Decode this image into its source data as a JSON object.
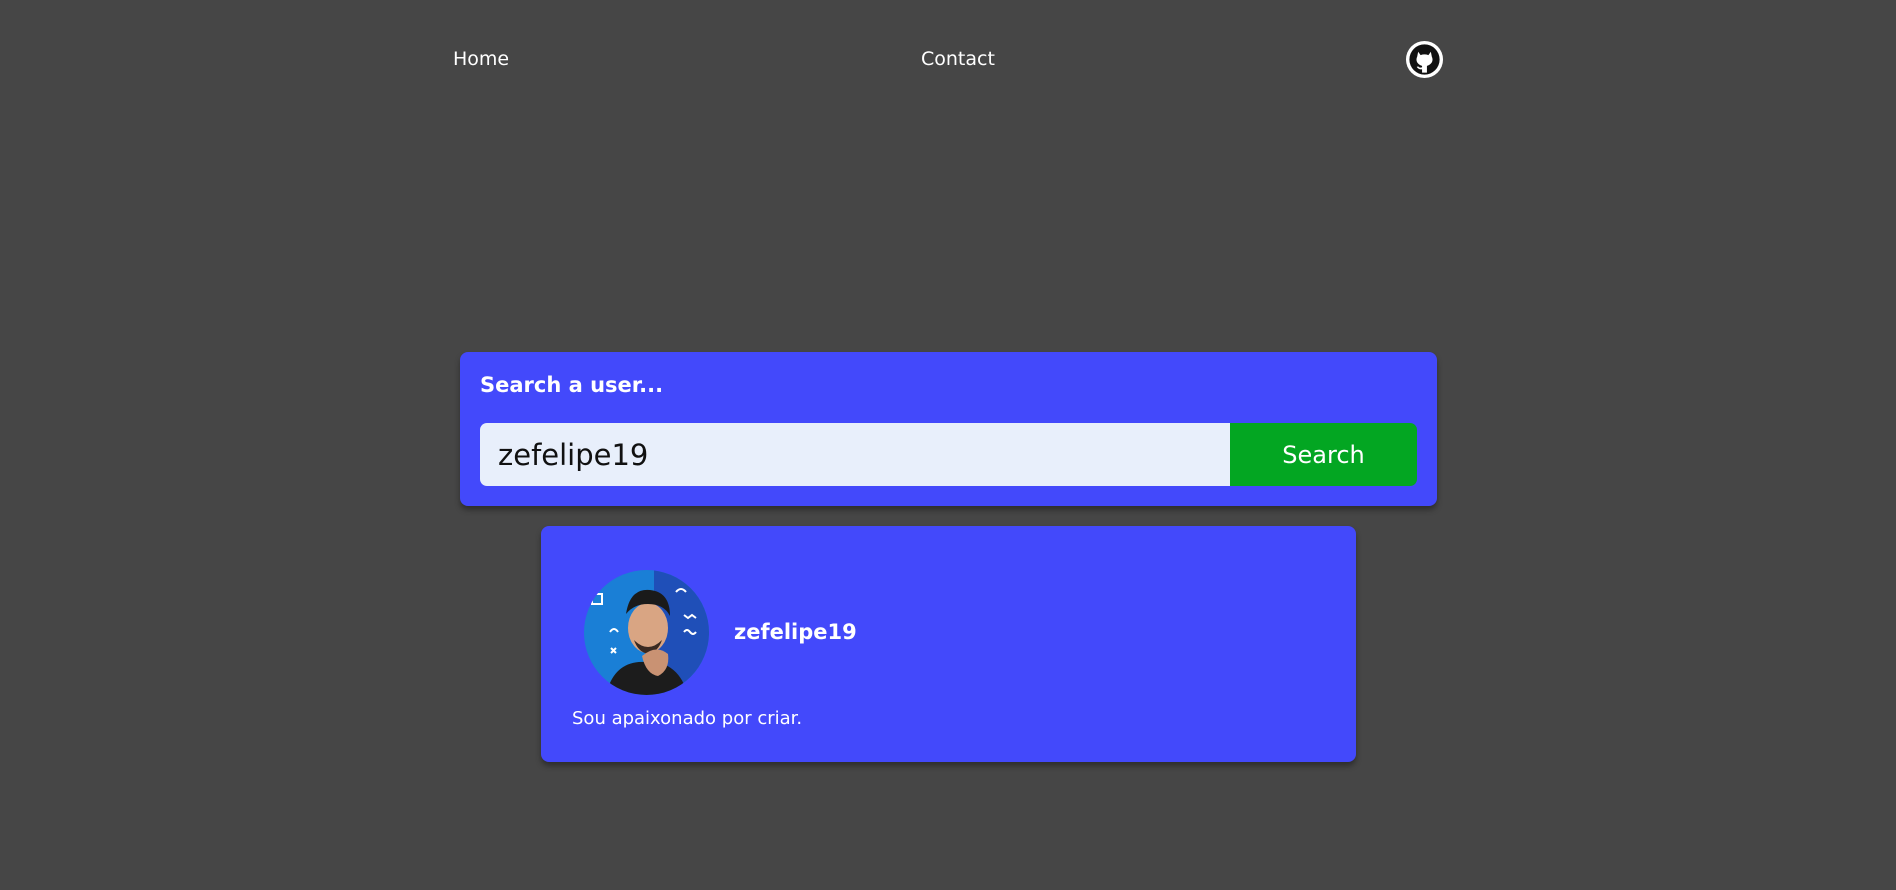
{
  "nav": {
    "home_label": "Home",
    "contact_label": "Contact",
    "github_icon": "github-icon"
  },
  "search": {
    "title": "Search a user...",
    "input_value": "zefelipe19",
    "button_label": "Search"
  },
  "profile": {
    "username": "zefelipe19",
    "bio": "Sou apaixonado por criar.",
    "avatar_icon": "user-avatar"
  },
  "colors": {
    "background": "#464646",
    "card": "#4349fb",
    "input_bg": "#e8effb",
    "button": "#03a622",
    "text": "#ffffff"
  }
}
